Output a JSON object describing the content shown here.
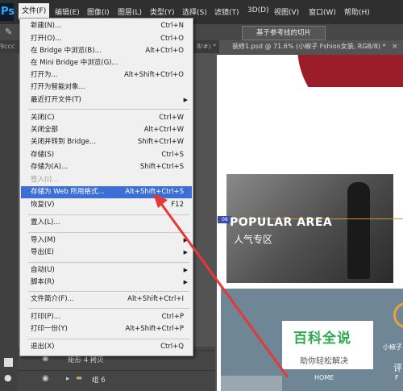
{
  "app": {
    "logo": "Ps"
  },
  "menubar": {
    "items": [
      "文件(F)",
      "编辑(E)",
      "图像(I)",
      "图层(L)",
      "类型(Y)",
      "选择(S)",
      "滤镜(T)",
      "3D(D)",
      "视图(V)",
      "窗口(W)",
      "帮助(H)"
    ]
  },
  "optionsbar": {
    "slice_button": "基于参考线的切片"
  },
  "tabs": {
    "left": "9ccc",
    "middle": "8/#) *",
    "active": "装修1.psd @ 71.6% (小椒子 Fshion女装, RGB/8) *"
  },
  "file_menu": {
    "items": [
      {
        "label": "新建(N)...",
        "shortcut": "Ctrl+N"
      },
      {
        "label": "打开(O)...",
        "shortcut": "Ctrl+O"
      },
      {
        "label": "在 Bridge 中浏览(B)...",
        "shortcut": "Alt+Ctrl+O"
      },
      {
        "label": "在 Mini Bridge 中浏览(G)...",
        "shortcut": ""
      },
      {
        "label": "打开为...",
        "shortcut": "Alt+Shift+Ctrl+O"
      },
      {
        "label": "打开为智能对象...",
        "shortcut": ""
      },
      {
        "label": "最近打开文件(T)",
        "shortcut": ""
      },
      {
        "label": "关闭(C)",
        "shortcut": "Ctrl+W"
      },
      {
        "label": "关闭全部",
        "shortcut": "Alt+Ctrl+W"
      },
      {
        "label": "关闭并转到 Bridge...",
        "shortcut": "Shift+Ctrl+W"
      },
      {
        "label": "存储(S)",
        "shortcut": "Ctrl+S"
      },
      {
        "label": "存储为(A)...",
        "shortcut": "Shift+Ctrl+S"
      },
      {
        "label": "签入(I)...",
        "shortcut": ""
      },
      {
        "label": "存储为 Web 所用格式...",
        "shortcut": "Alt+Shift+Ctrl+S"
      },
      {
        "label": "恢复(V)",
        "shortcut": "F12"
      },
      {
        "label": "置入(L)...",
        "shortcut": ""
      },
      {
        "label": "导入(M)",
        "shortcut": ""
      },
      {
        "label": "导出(E)",
        "shortcut": ""
      },
      {
        "label": "自动(U)",
        "shortcut": ""
      },
      {
        "label": "脚本(R)",
        "shortcut": ""
      },
      {
        "label": "文件简介(F)...",
        "shortcut": "Alt+Shift+Ctrl+I"
      },
      {
        "label": "打印(P)...",
        "shortcut": "Ctrl+P"
      },
      {
        "label": "打印一份(Y)",
        "shortcut": "Alt+Shift+Ctrl+P"
      },
      {
        "label": "退出(X)",
        "shortcut": "Ctrl+Q"
      }
    ]
  },
  "layers": {
    "row1": "矩形 4 拷贝",
    "row2": "组 6"
  },
  "canvas": {
    "popular": "POPULAR AREA",
    "popular_cn": "人气专区",
    "slice_tag": "06",
    "home": "HOME",
    "side_cn": "小椒子",
    "side_ping": "评",
    "side_f": "F"
  },
  "watermark": {
    "title": "百科全说",
    "subtitle": "助你轻松解决"
  },
  "colors": {
    "highlight": "#3b6fd6",
    "arrow": "#e53935",
    "watermark_green": "#2aaa4a"
  }
}
